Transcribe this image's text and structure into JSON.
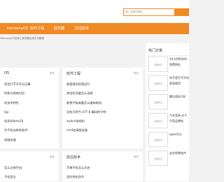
{
  "search": {
    "placeholder": "输入关键词搜索"
  },
  "nav": {
    "items": [
      "HarmonyOS",
      "软件工程",
      "服务器",
      "前沿技术"
    ]
  },
  "breadcrumb": "HarmonyOS应用上架流程实用方法教程",
  "panels": [
    {
      "title": "OS",
      "more": "更多",
      "items": [
        "机型打不开怎么回事",
        "性能与耗电对比",
        "的技术特性",
        "lpp",
        "机测试beta10",
        "为手机自带的软件",
        "加服务器"
      ]
    },
    {
      "title": "软件工程",
      "more": "更多",
      "items": [
        "被管理员权限运行",
        "海信机顶盒怎么连接",
        "联想平板电脑怎么重新刷机",
        "没有可转为 UTF-8 编码的字符",
        "switch游戏机",
        "cmd连接服务器"
      ]
    },
    {
      "title": "前沿技术",
      "more": "更多",
      "items": [
        "苹果手机怎么开启",
        "定时关机命令"
      ]
    },
    {
      "title": "",
      "more": "更多",
      "items": [
        "怎么注销手机",
        "手机显示"
      ]
    }
  ],
  "hot": {
    "title": "热门文章",
    "thumb_label": "该图暂无",
    "items": [
      "24小时的实时免费网址",
      "你不是打不开吗 登录使用",
      "腾讯游戏 OK",
      "汽车音响 对于不同品牌的",
      "apex可以",
      "这些免费软件"
    ]
  }
}
